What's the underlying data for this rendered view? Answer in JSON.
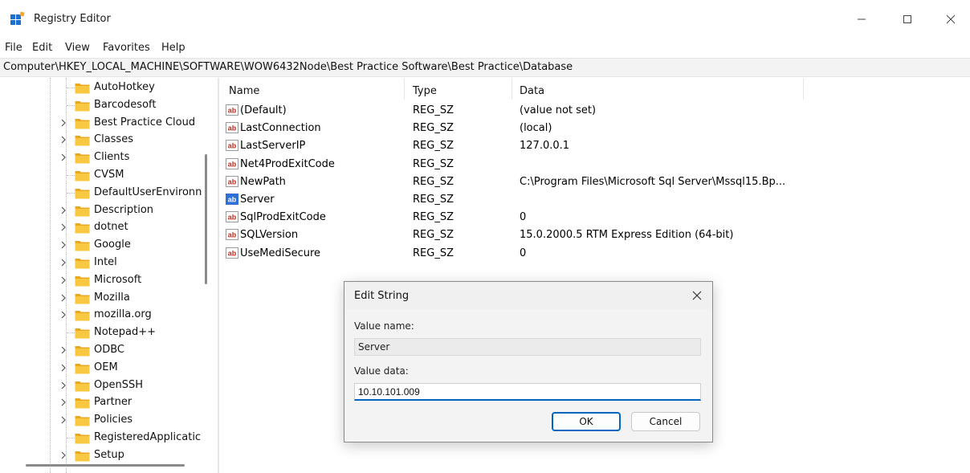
{
  "window": {
    "title": "Registry Editor",
    "app_icon": "registry-editor-icon",
    "controls": [
      "minimize-icon",
      "maximize-icon",
      "close-icon"
    ]
  },
  "menu": [
    "File",
    "Edit",
    "View",
    "Favorites",
    "Help"
  ],
  "address": "Computer\\HKEY_LOCAL_MACHINE\\SOFTWARE\\WOW6432Node\\Best Practice Software\\Best Practice\\Database",
  "tree": [
    {
      "label": "AutoHotkey",
      "expandable": false
    },
    {
      "label": "Barcodesoft",
      "expandable": false
    },
    {
      "label": "Best Practice Cloud",
      "expandable": true
    },
    {
      "label": "Classes",
      "expandable": true
    },
    {
      "label": "Clients",
      "expandable": true
    },
    {
      "label": "CVSM",
      "expandable": false
    },
    {
      "label": "DefaultUserEnvironn",
      "expandable": false
    },
    {
      "label": "Description",
      "expandable": true
    },
    {
      "label": "dotnet",
      "expandable": true
    },
    {
      "label": "Google",
      "expandable": true
    },
    {
      "label": "Intel",
      "expandable": true
    },
    {
      "label": "Microsoft",
      "expandable": true
    },
    {
      "label": "Mozilla",
      "expandable": true
    },
    {
      "label": "mozilla.org",
      "expandable": true
    },
    {
      "label": "Notepad++",
      "expandable": false
    },
    {
      "label": "ODBC",
      "expandable": true
    },
    {
      "label": "OEM",
      "expandable": true
    },
    {
      "label": "OpenSSH",
      "expandable": true
    },
    {
      "label": "Partner",
      "expandable": true
    },
    {
      "label": "Policies",
      "expandable": true
    },
    {
      "label": "RegisteredApplicatic",
      "expandable": false
    },
    {
      "label": "Setup",
      "expandable": true
    }
  ],
  "list": {
    "headers": {
      "name": "Name",
      "type": "Type",
      "data": "Data"
    },
    "rows": [
      {
        "name": "(Default)",
        "type": "REG_SZ",
        "data": "(value not set)",
        "selected": false
      },
      {
        "name": "LastConnection",
        "type": "REG_SZ",
        "data": "(local)",
        "selected": false
      },
      {
        "name": "LastServerIP",
        "type": "REG_SZ",
        "data": "127.0.0.1",
        "selected": false
      },
      {
        "name": "Net4ProdExitCode",
        "type": "REG_SZ",
        "data": "",
        "selected": false
      },
      {
        "name": "NewPath",
        "type": "REG_SZ",
        "data": "C:\\Program Files\\Microsoft Sql Server\\Mssql15.Bp...",
        "selected": false
      },
      {
        "name": "Server",
        "type": "REG_SZ",
        "data": "",
        "selected": true
      },
      {
        "name": "SqlProdExitCode",
        "type": "REG_SZ",
        "data": "0",
        "selected": false
      },
      {
        "name": "SQLVersion",
        "type": "REG_SZ",
        "data": "15.0.2000.5 RTM Express Edition (64-bit)",
        "selected": false
      },
      {
        "name": "UseMediSecure",
        "type": "REG_SZ",
        "data": "0",
        "selected": false
      }
    ]
  },
  "dialog": {
    "title": "Edit String",
    "value_name_label": "Value name:",
    "value_name": "Server",
    "value_data_label": "Value data:",
    "value_data": "10.10.101.009",
    "ok_label": "OK",
    "cancel_label": "Cancel"
  },
  "colors": {
    "accent": "#0067c0",
    "folder": "#f8c842",
    "folder_dark": "#e8a920",
    "string_icon_text": "#c42b1c"
  }
}
